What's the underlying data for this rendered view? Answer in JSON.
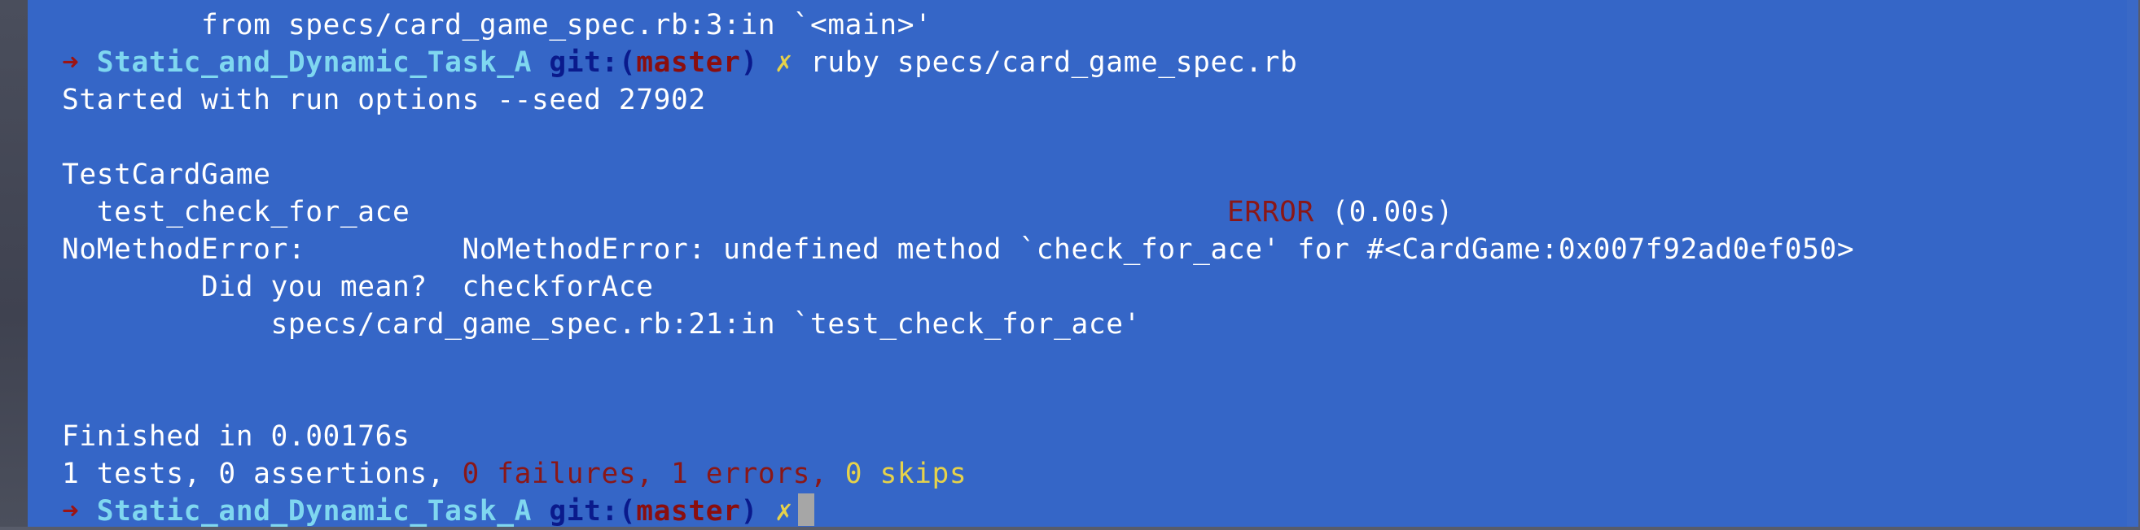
{
  "colors": {
    "terminal_bg": "#3566c7",
    "prompt_arrow": "#9b1414",
    "prompt_dir": "#7fd7f0",
    "git_label": "#0a1a8c",
    "branch": "#8a0e0e",
    "dirty_marker": "#e6d24a",
    "error_text": "#8a1717",
    "skips_text": "#e6d24a"
  },
  "lines": {
    "l0": "        from specs/card_game_spec.rb:3:in `<main>'",
    "prompt1": {
      "arrow": "➜",
      "dir": "Static_and_Dynamic_Task_A",
      "git": "git:(",
      "branch": "master",
      "git_close": ")",
      "dirty": "✗",
      "command": "ruby specs/card_game_spec.rb"
    },
    "l2": "Started with run options --seed 27902",
    "l4": "TestCardGame",
    "l5_test": "  test_check_for_ace",
    "l5_status": "ERROR",
    "l5_time": " (0.00s)",
    "l6": "NoMethodError:         NoMethodError: undefined method `check_for_ace' for #<CardGame:0x007f92ad0ef050>",
    "l7": "        Did you mean?  checkforAce",
    "l8": "            specs/card_game_spec.rb:21:in `test_check_for_ace'",
    "l11": "Finished in 0.00176s",
    "summary": {
      "prefix": "1 tests, 0 assertions, ",
      "failures": "0 failures, ",
      "errors": "1 errors, ",
      "skips": "0 skips"
    },
    "prompt2": {
      "arrow": "➜",
      "dir": "Static_and_Dynamic_Task_A",
      "git": "git:(",
      "branch": "master",
      "git_close": ")",
      "dirty": "✗"
    }
  }
}
